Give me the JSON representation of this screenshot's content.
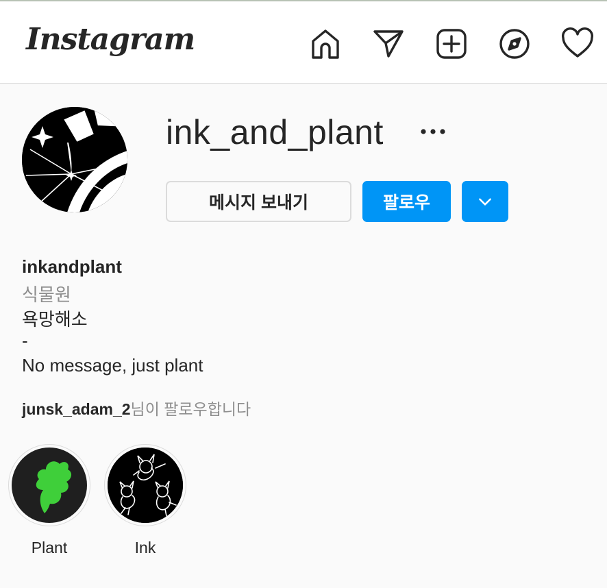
{
  "header": {
    "logo_text": "Instagram",
    "nav_icons": [
      "home-icon",
      "direct-message-icon",
      "new-post-icon",
      "explore-icon",
      "activity-heart-icon"
    ]
  },
  "profile": {
    "username": "ink_and_plant",
    "more_icon": "more-options-icon",
    "message_button_label": "메시지 보내기",
    "follow_button_label": "팔로우",
    "dropdown_icon": "chevron-down-icon"
  },
  "bio": {
    "name": "inkandplant",
    "category": "식물원",
    "lines": [
      "욕망해소",
      "-",
      "No message, just plant"
    ]
  },
  "followed_by": {
    "username": "junsk_adam_2",
    "suffix": "님이 팔로우합니다"
  },
  "highlights": [
    {
      "label": "Plant"
    },
    {
      "label": "Ink"
    }
  ],
  "colors": {
    "accent": "#0095f6",
    "text": "#262626",
    "secondary_text": "#8e8e8e",
    "border": "#dbdbdb",
    "background": "#fafafa",
    "plant_green": "#3fcf3a"
  }
}
